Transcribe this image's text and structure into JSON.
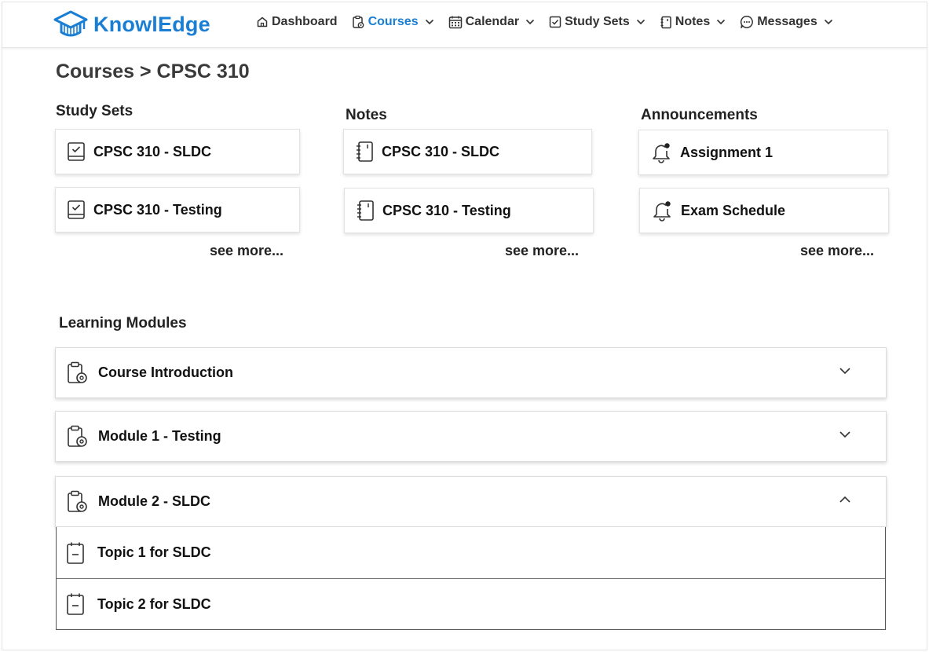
{
  "app": {
    "name": "KnowlEdge",
    "accent_color": "#1a7fd4"
  },
  "nav": {
    "items": [
      {
        "label": "Dashboard",
        "icon": "home-icon",
        "dropdown": false,
        "active": false
      },
      {
        "label": "Courses",
        "icon": "clipboard-icon",
        "dropdown": true,
        "active": true
      },
      {
        "label": "Calendar",
        "icon": "calendar-icon",
        "dropdown": true,
        "active": false
      },
      {
        "label": "Study Sets",
        "icon": "checkbox-icon",
        "dropdown": true,
        "active": false
      },
      {
        "label": "Notes",
        "icon": "notebook-icon",
        "dropdown": true,
        "active": false
      },
      {
        "label": "Messages",
        "icon": "chat-icon",
        "dropdown": true,
        "active": false
      }
    ]
  },
  "breadcrumb": "Courses > CPSC 310",
  "study_sets": {
    "title": "Study Sets",
    "items": [
      "CPSC 310 - SLDC",
      "CPSC 310 - Testing"
    ],
    "see_more": "see more..."
  },
  "notes": {
    "title": "Notes",
    "items": [
      "CPSC 310 - SLDC",
      "CPSC 310 - Testing"
    ],
    "see_more": "see more..."
  },
  "announcements": {
    "title": "Announcements",
    "items": [
      "Assignment 1",
      "Exam Schedule"
    ],
    "see_more": "see more..."
  },
  "learning_modules": {
    "title": "Learning Modules",
    "modules": [
      {
        "label": "Course Introduction",
        "expanded": false
      },
      {
        "label": "Module 1 - Testing",
        "expanded": false
      },
      {
        "label": "Module 2 - SLDC",
        "expanded": true
      }
    ],
    "topics": [
      "Topic 1 for SLDC",
      "Topic 2 for SLDC"
    ]
  }
}
